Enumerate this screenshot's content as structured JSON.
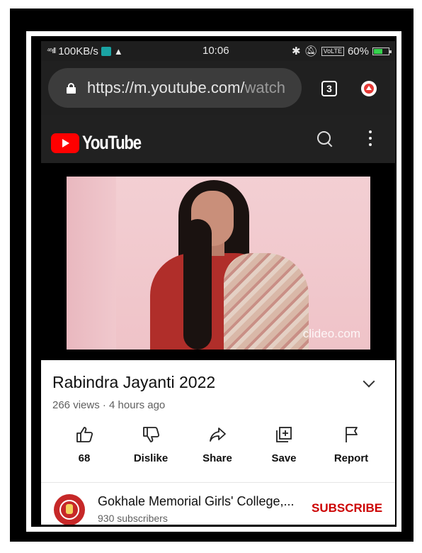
{
  "status_bar": {
    "signal": "⁴⁶ıll",
    "speed": "100KB/s",
    "time": "10:06",
    "volte": "VoLTE",
    "battery": "60%",
    "battery_level": 0.6,
    "battery_color": "#35d24d"
  },
  "browser": {
    "url_main": "https://m.youtube.com/",
    "url_tail": "watch",
    "tab_count": "3"
  },
  "youtube": {
    "logo_text": "YouTube",
    "brand_color": "#ff0000"
  },
  "video": {
    "watermark": "clideo.com",
    "title": "Rabindra Jayanti 2022",
    "meta": "266 views · 4 hours ago"
  },
  "actions": [
    {
      "label": "68",
      "icon": "thumbs-up-icon"
    },
    {
      "label": "Dislike",
      "icon": "thumbs-down-icon"
    },
    {
      "label": "Share",
      "icon": "share-icon"
    },
    {
      "label": "Save",
      "icon": "save-playlist-icon"
    },
    {
      "label": "Report",
      "icon": "flag-icon"
    }
  ],
  "channel": {
    "name": "Gokhale Memorial Girls' College,...",
    "subscribers": "930 subscribers",
    "subscribe_label": "SUBSCRIBE",
    "subscribe_color": "#cc0000"
  }
}
